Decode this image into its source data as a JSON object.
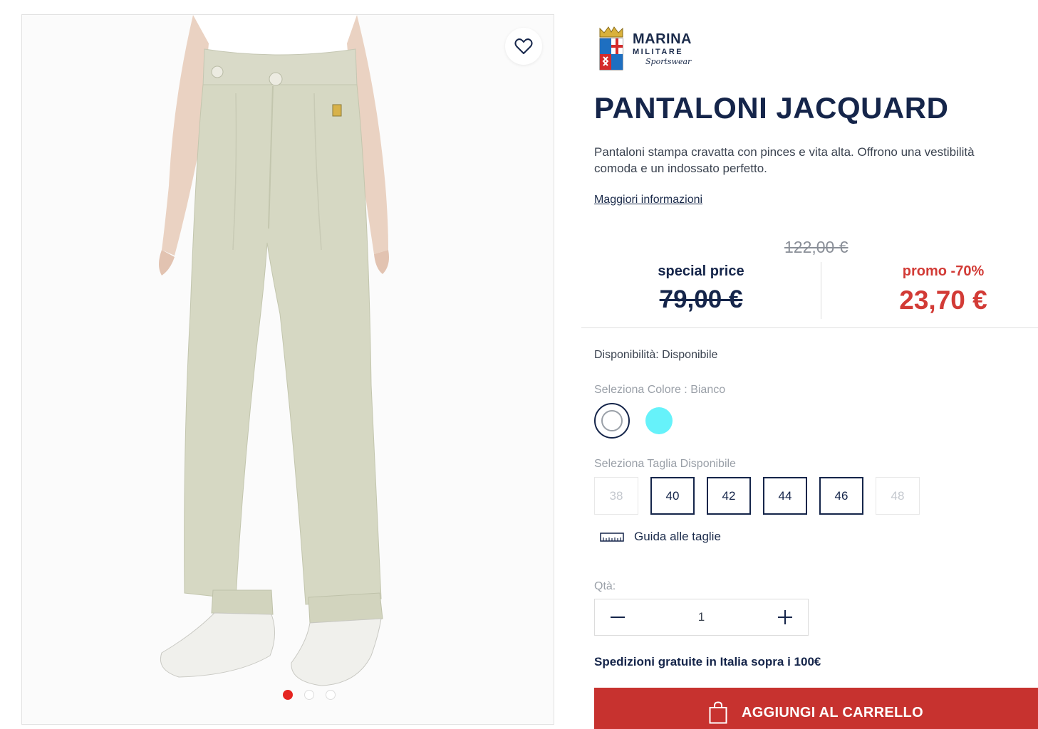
{
  "brand": {
    "name": "MARINA",
    "sub": "MILITARE",
    "script": "Sportswear"
  },
  "product": {
    "title": "PANTALONI JACQUARD",
    "description_lines": [
      "Pantaloni stampa cravatta con pinces e vita alta. Offrono una vestibilità",
      "comoda e un indossato perfetto."
    ],
    "more_info": "Maggiori informazioni"
  },
  "pricing": {
    "original": "122,00 €",
    "special_label": "special price",
    "special_value": "79,00 €",
    "promo_label": "promo -70%",
    "promo_value": "23,70 €"
  },
  "availability": "Disponibilità: Disponibile",
  "colors": {
    "label": "Seleziona Colore : Bianco",
    "options": [
      {
        "name": "Bianco",
        "hex": "#ffffff",
        "selected": true
      },
      {
        "name": "Azzurro",
        "hex": "#66f2fa",
        "selected": false
      }
    ]
  },
  "sizes": {
    "label": "Seleziona Taglia Disponibile",
    "options": [
      {
        "label": "38",
        "available": false
      },
      {
        "label": "40",
        "available": true
      },
      {
        "label": "42",
        "available": true
      },
      {
        "label": "44",
        "available": true
      },
      {
        "label": "46",
        "available": true
      },
      {
        "label": "48",
        "available": false
      }
    ],
    "guide": "Guida alle taglie"
  },
  "quantity": {
    "label": "Qtà:",
    "value": "1"
  },
  "shipping_note": "Spedizioni gratuite in Italia sopra i 100€",
  "cart_button": "AGGIUNGI AL CARRELLO",
  "gallery": {
    "slides": 3,
    "active_slide": 1
  },
  "theme": {
    "navy": "#15254a",
    "promo_red": "#d23b36",
    "cart_red": "#c7322f",
    "active_dot": "#e52521"
  }
}
